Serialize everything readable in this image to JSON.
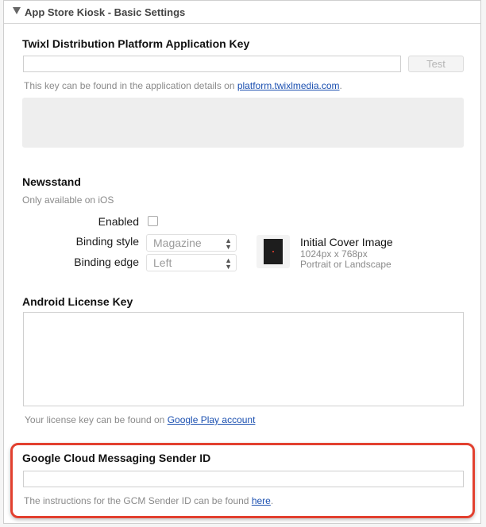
{
  "header": {
    "title": "App Store Kiosk - Basic Settings"
  },
  "twixl": {
    "heading": "Twixl Distribution Platform Application Key",
    "key_value": "",
    "test_label": "Test",
    "hint_prefix": "This key can be found in the application details on ",
    "hint_link": "platform.twixlmedia.com",
    "hint_suffix": "."
  },
  "newsstand": {
    "heading": "Newsstand",
    "subtitle": "Only available on iOS",
    "enabled_label": "Enabled",
    "enabled_checked": false,
    "binding_style_label": "Binding style",
    "binding_style_value": "Magazine",
    "binding_edge_label": "Binding edge",
    "binding_edge_value": "Left",
    "cover_title": "Initial Cover Image",
    "cover_size": "1024px x 768px",
    "cover_orientation": "Portrait or Landscape"
  },
  "android": {
    "heading": "Android License Key",
    "hint_prefix": "Your license key can be found on ",
    "hint_link": "Google Play account"
  },
  "gcm": {
    "heading": "Google Cloud Messaging Sender ID",
    "value": "",
    "hint_prefix": "The instructions for the GCM Sender ID can be found ",
    "hint_link": "here",
    "hint_suffix": "."
  },
  "colors": {
    "highlight": "#e2402f",
    "link": "#1a4fb0"
  }
}
